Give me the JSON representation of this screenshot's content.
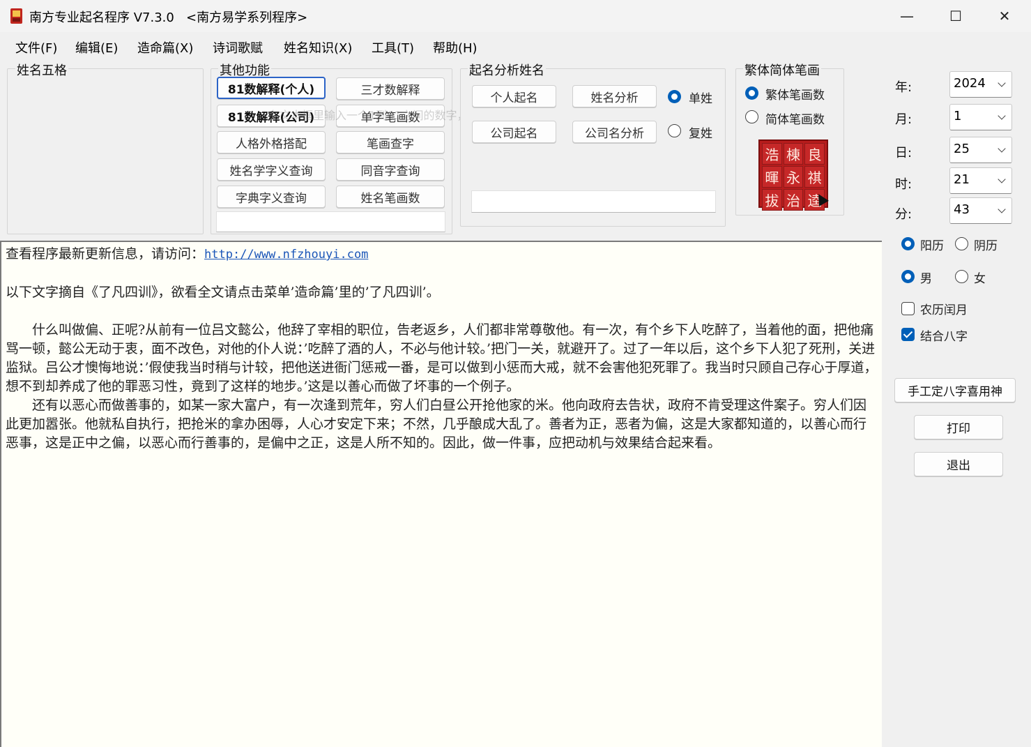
{
  "window": {
    "title": "南方专业起名程序 V7.3.0   <南方易学系列程序>",
    "controls": {
      "minimize": "—",
      "maximize": "☐",
      "close": "✕"
    }
  },
  "menu": [
    "文件(F)",
    "编辑(E)",
    "造命篇(X)",
    "诗词歌赋",
    "姓名知识(X)",
    "工具(T)",
    "帮助(H)"
  ],
  "groups": {
    "wuge": {
      "title": "姓名五格"
    },
    "other": {
      "title": "其他功能",
      "buttons": [
        "81数解释(个人)",
        "三才数解释",
        "81数解释(公司)",
        "单字笔画数",
        "人格外格搭配",
        "笔画查字",
        "姓名学字义查询",
        "同音字查询",
        "字典字义查询",
        "姓名笔画数"
      ],
      "hint": "在文本框里输入一个1到81之间的数字，然后点击此按钮。"
    },
    "naming": {
      "title": "起名分析姓名",
      "buttons": [
        "个人起名",
        "姓名分析",
        "公司起名",
        "公司名分析"
      ],
      "radios": [
        "单姓",
        "复姓"
      ]
    },
    "strokes": {
      "title": "繁体简体笔画",
      "radios": [
        "繁体笔画数",
        "简体笔画数"
      ],
      "seal": [
        "浩",
        "棟",
        "良",
        "暉",
        "永",
        "祺",
        "拔",
        "治",
        "逵"
      ]
    }
  },
  "datetime": {
    "year": {
      "label": "年:",
      "value": "2024"
    },
    "month": {
      "label": "月:",
      "value": "1"
    },
    "day": {
      "label": "日:",
      "value": "25"
    },
    "hour": {
      "label": "时:",
      "value": "21"
    },
    "minute": {
      "label": "分:",
      "value": "43"
    }
  },
  "options": {
    "calendar": [
      "阳历",
      "阴历"
    ],
    "gender": [
      "男",
      "女"
    ],
    "leap": "农历闰月",
    "bazi": "结合八字"
  },
  "side_buttons": {
    "manual": "手工定八字喜用神",
    "print": "打印",
    "exit": "退出"
  },
  "content": {
    "line1_prefix": "查看程序最新更新信息，请访问：",
    "url": "http://www.nfzhouyi.com",
    "line2": "以下文字摘自《了凡四训》，欲看全文请点击菜单’造命篇’里的’了凡四训’。",
    "para1": "什么叫做偏、正呢?从前有一位吕文懿公，他辞了宰相的职位，告老返乡，人们都非常尊敬他。有一次，有个乡下人吃醉了，当着他的面，把他痛骂一顿，懿公无动于衷，面不改色，对他的仆人说：’吃醉了酒的人，不必与他计较。’把门一关，就避开了。过了一年以后，这个乡下人犯了死刑，关进监狱。吕公才懊悔地说：’假使我当时稍与计较，把他送进衙门惩戒一番，是可以做到小惩而大戒，就不会害他犯死罪了。我当时只顾自己存心于厚道，想不到却养成了他的罪恶习性，竟到了这样的地步。’这是以善心而做了坏事的一个例子。",
    "para2": "还有以恶心而做善事的，如某一家大富户，有一次逢到荒年，穷人们白昼公开抢他家的米。他向政府去告状，政府不肯受理这件案子。穷人们因此更加嚣张。他就私自执行，把抢米的拿办困辱，人心才安定下来；不然，几乎酿成大乱了。善者为正，恶者为偏，这是大家都知道的，以善心而行恶事，这是正中之偏，以恶心而行善事的，是偏中之正，这是人所不知的。因此，做一件事，应把动机与效果结合起来看。"
  },
  "colors": {
    "accent": "#005fb8",
    "link": "#1a55b8",
    "seal": "#b71c1c"
  }
}
